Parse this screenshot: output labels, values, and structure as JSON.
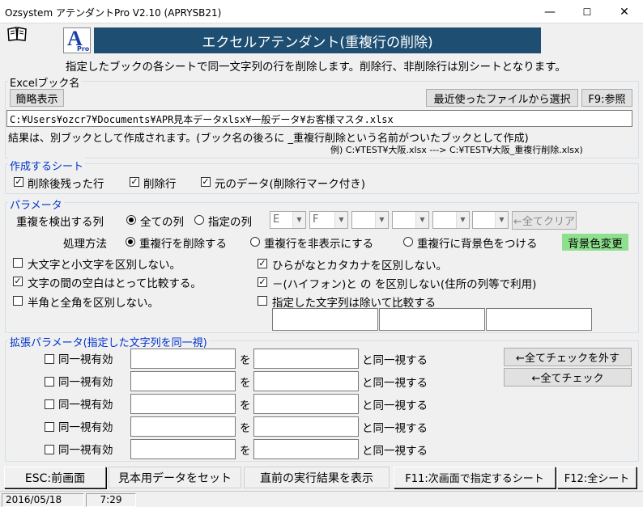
{
  "window": {
    "title": "Ozsystem アテンダントPro V2.10 (APRYSB21)",
    "minimize": "—",
    "maximize": "☐",
    "close": "✕"
  },
  "header": {
    "banner_title": "エクセルアテンダント(重複行の削除)",
    "logo_letter": "A",
    "logo_sub": "Pro",
    "description": "指定したブックの各シートで同一文字列の行を削除します。削除行、非削除行は別シートとなります。"
  },
  "excel_book": {
    "group_label": "Excelブック名",
    "simple_display": "簡略表示",
    "recent_files": "最近使ったファイルから選択",
    "browse": "F9:参照",
    "path": "C:¥Users¥ozcr7¥Documents¥APR見本データxlsx¥一般データ¥お客様マスタ.xlsx",
    "result_note": "結果は、別ブックとして作成されます。(ブック名の後ろに _重複行削除という名前がついたブックとして作成)",
    "example": "例) C:¥TEST¥大阪.xlsx ---> C:¥TEST¥大阪_重複行削除.xlsx)"
  },
  "sheets": {
    "group_label": "作成するシート",
    "items": [
      {
        "label": "削除後残った行",
        "checked": true
      },
      {
        "label": "削除行",
        "checked": true
      },
      {
        "label": "元のデータ(削除行マーク付き)",
        "checked": true
      }
    ]
  },
  "params": {
    "group_label": "パラメータ",
    "detect_label": "重複を検出する列",
    "all_columns": "全ての列",
    "specified_columns": "指定の列",
    "col_selects": [
      "E",
      "F",
      "",
      "",
      "",
      ""
    ],
    "clear_all": "←全てクリア",
    "method_label": "処理方法",
    "method_delete": "重複行を削除する",
    "method_hide": "重複行を非表示にする",
    "method_color": "重複行に背景色をつける",
    "bg_color_change": "背景色変更",
    "options_left": [
      {
        "label": "大文字と小文字を区別しない。",
        "checked": false
      },
      {
        "label": "文字の間の空白はとって比較する。",
        "checked": true
      },
      {
        "label": "半角と全角を区別しない。",
        "checked": false
      }
    ],
    "options_right": [
      {
        "label": "ひらがなとカタカナを区別しない。",
        "checked": true
      },
      {
        "label": "－(ハイフォン)と の を区別しない(住所の列等で利用)",
        "checked": true
      },
      {
        "label": "指定した文字列は除いて比較する",
        "checked": false
      }
    ]
  },
  "extended": {
    "group_label": "拡張パラメータ(指定した文字列を同一視)",
    "enable_label": "同一視有効",
    "wo": "を",
    "same_as": "と同一視する",
    "uncheck_all": "←全てチェックを外す",
    "check_all": "←全てチェック",
    "rows": 5
  },
  "footer": {
    "esc": "ESC:前画面",
    "sample": "見本用データをセット",
    "last_result": "直前の実行結果を表示",
    "f11": "F11:次画面で指定するシート",
    "f12": "F12:全シート"
  },
  "status": {
    "date": "2016/05/18",
    "time": "7:29"
  }
}
